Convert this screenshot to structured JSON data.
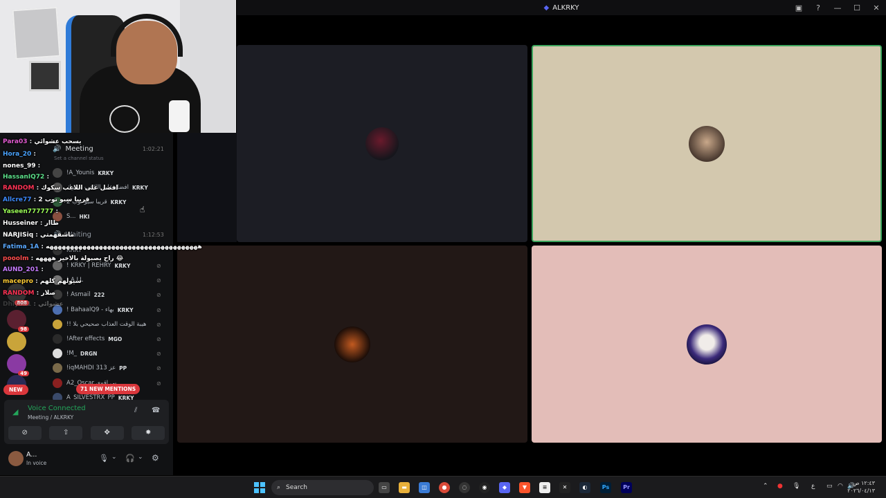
{
  "window": {
    "title": "ALKRKY"
  },
  "tiles": [
    {
      "name": "tile-1",
      "bg": "#1c1d24"
    },
    {
      "name": "tile-2",
      "bg": "#d3c8ae",
      "speaking": true
    },
    {
      "name": "tile-3",
      "bg": "#221816"
    },
    {
      "name": "tile-4",
      "bg": "#e3bdb8"
    }
  ],
  "channels": {
    "meeting": {
      "label": "Meeting",
      "time": "1:02:21",
      "status": "Set a channel status"
    },
    "waiting": {
      "label": "Waiting",
      "time": "1:12:53"
    }
  },
  "voice_users": [
    {
      "name": "!A_Younis",
      "tag": "KRKY"
    },
    {
      "name": "افضل على اللاعب سكوك",
      "tag": "KRKY"
    },
    {
      "name": "قريبا سبو توب 2",
      "tag": "KRKY"
    },
    {
      "name": "S...",
      "tag": "HKI"
    },
    {
      "name": "KRKY",
      "tag": ""
    },
    {
      "name": "! KRKY | REHRY",
      "tag": "KRKY"
    },
    {
      "name": "! A.LL",
      "tag": ""
    },
    {
      "name": "! Asmail",
      "tag": "222"
    },
    {
      "name": "! BahaalQ9 - بهاء",
      "tag": "KRKY"
    },
    {
      "name": "!! هيبة الوقت العذاب صحيحي بلا",
      "tag": ""
    },
    {
      "name": "!After effects",
      "tag": "MGO"
    },
    {
      "name": "!M_",
      "tag": "DRGN"
    },
    {
      "name": "!iqMAHDI 313 عز",
      "tag": "PP"
    },
    {
      "name": "A2_Oscar بي اقوى",
      "tag": ""
    },
    {
      "name": "A_SILVESTRX_PP",
      "tag": "KRKY"
    }
  ],
  "guild_badges": [
    "808",
    "98",
    "49"
  ],
  "chat": [
    {
      "user": "Para03",
      "color": "#e05bd0",
      "msg": "يسحب عشوائي"
    },
    {
      "user": "Hora_20",
      "color": "#4aa3ff",
      "msg": ""
    },
    {
      "user": "nones_99",
      "color": "#ffffff",
      "msg": ""
    },
    {
      "user": "HassanIQ72",
      "color": "#5ce08a",
      "msg": ""
    },
    {
      "user": "RANDOM",
      "color": "#ff3355",
      "msg": "افضل على اللاعب سكوك"
    },
    {
      "user": "Allcre77",
      "color": "#3d8bff",
      "msg": "قريبا سبو توب 2"
    },
    {
      "user": "Yaseen777777",
      "color": "#9cff57",
      "msg": ""
    },
    {
      "user": "Husseiner",
      "color": "#ffffff",
      "msg": "طاار"
    },
    {
      "user": "NARJISiq",
      "color": "#ffffff",
      "msg": "ماشفهمتي"
    },
    {
      "user": "Fatima_1A",
      "color": "#5aa9ff",
      "msg": "هههههههههههههههههههههههههههههههههههههه"
    },
    {
      "user": "pooolm",
      "color": "#ff4d4d",
      "msg": "راح يصبولة بالاخير ههههه 😂"
    },
    {
      "user": "AUND_201",
      "color": "#c67bff",
      "msg": ""
    },
    {
      "user": "macepro",
      "color": "#ffcc33",
      "msg": "سيولهم كلهم"
    },
    {
      "user": "RANDOM",
      "color": "#ff3355",
      "msg": "صلار"
    },
    {
      "user": "Dhiyaa1",
      "color": "#888888",
      "msg": "عشوائي"
    }
  ],
  "voice_panel": {
    "status": "Voice Connected",
    "location": "Meeting / ALKRKY"
  },
  "user_panel": {
    "name": "A...",
    "status": "In voice"
  },
  "new_pill": "NEW",
  "mentions_pill": "71 NEW MENTIONS",
  "taskbar": {
    "search_placeholder": "Search",
    "clock_time": "١٢:٤٣ ص",
    "clock_date": "٢٠٢٦/٠٤/١٣",
    "lang": "ع"
  },
  "colors": {
    "discord_green": "#23a55a",
    "red_badge": "#da373c",
    "speaking_border": "#3ba55c"
  }
}
